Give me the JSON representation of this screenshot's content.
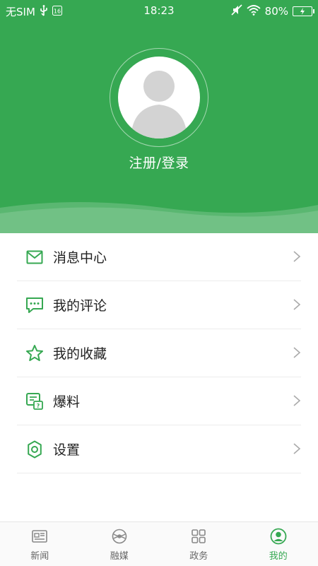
{
  "status_bar": {
    "carrier": "无SIM",
    "time": "18:23",
    "battery": "80%"
  },
  "profile": {
    "login_text": "注册/登录"
  },
  "menu": {
    "items": [
      {
        "label": "消息中心",
        "icon": "mail-icon"
      },
      {
        "label": "我的评论",
        "icon": "comment-icon"
      },
      {
        "label": "我的收藏",
        "icon": "star-icon"
      },
      {
        "label": "爆料",
        "icon": "tip-off-icon"
      },
      {
        "label": "设置",
        "icon": "settings-icon"
      }
    ]
  },
  "tabbar": {
    "items": [
      {
        "label": "新闻",
        "icon": "news-icon",
        "active": false
      },
      {
        "label": "融媒",
        "icon": "media-icon",
        "active": false
      },
      {
        "label": "政务",
        "icon": "grid-icon",
        "active": false
      },
      {
        "label": "我的",
        "icon": "profile-icon",
        "active": true
      }
    ]
  },
  "colors": {
    "accent": "#36a852",
    "header_bg": "#36a852",
    "icon_green": "#36a852",
    "divider": "#ececec",
    "tab_inactive": "#666666"
  }
}
